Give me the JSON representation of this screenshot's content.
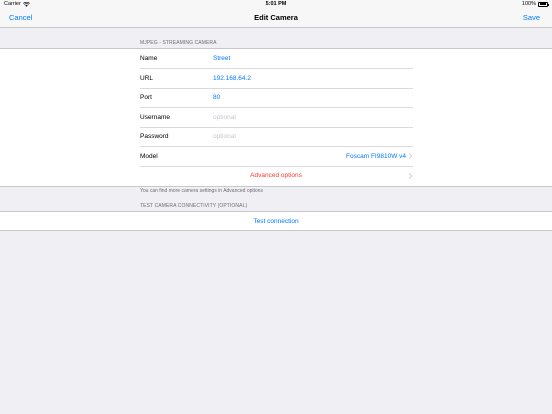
{
  "status_bar": {
    "carrier": "Carrier",
    "time": "5:01 PM",
    "battery": "100%"
  },
  "nav": {
    "cancel_label": "Cancel",
    "title": "Edit Camera",
    "save_label": "Save"
  },
  "camera_section": {
    "header": "MJPEG - STREAMING CAMERA",
    "fields": {
      "name": {
        "label": "Name",
        "value": "Street"
      },
      "url": {
        "label": "URL",
        "value": "192.168.64.2"
      },
      "port": {
        "label": "Port",
        "value": "80"
      },
      "username": {
        "label": "Username",
        "placeholder": "optional"
      },
      "password": {
        "label": "Password",
        "placeholder": "optional"
      },
      "model": {
        "label": "Model",
        "value": "Foscam FI9810W v4"
      }
    },
    "advanced_label": "Advanced options",
    "footer": "You can find more camera settings in Advanced options"
  },
  "test_section": {
    "header": "TEST CAMERA CONNECTIVITY (OPTIONAL)",
    "button_label": "Test connection"
  },
  "colors": {
    "accent": "#007aff",
    "destructive": "#ff3b30",
    "background": "#efeff4"
  }
}
